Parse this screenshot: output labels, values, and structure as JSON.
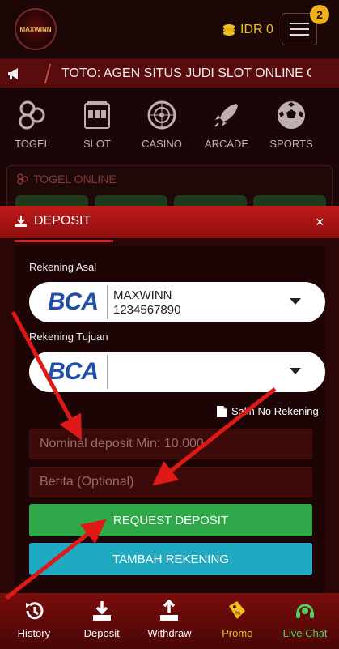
{
  "header": {
    "logo_text": "MAXWINN",
    "balance": "IDR 0",
    "notification_count": "2"
  },
  "marquee": {
    "text": "TOTO: AGEN SITUS JUDI SLOT ONLINE GACOR"
  },
  "games": [
    {
      "label": "TOGEL",
      "icon": "lottery-balls-icon"
    },
    {
      "label": "SLOT",
      "icon": "slot-machine-icon"
    },
    {
      "label": "CASINO",
      "icon": "roulette-icon"
    },
    {
      "label": "ARCADE",
      "icon": "rocket-icon"
    },
    {
      "label": "SPORTS",
      "icon": "soccer-ball-icon"
    }
  ],
  "togel": {
    "title": "TOGEL ONLINE"
  },
  "deposit": {
    "title": "DEPOSIT",
    "close": "×",
    "source_label": "Rekening Asal",
    "source_bank": "BCA",
    "source_name": "MAXWINN",
    "source_number": "1234567890",
    "target_label": "Rekening Tujuan",
    "target_bank": "BCA",
    "save_account": "Salin No Rekening",
    "amount_placeholder": "Nominal deposit Min: 10.000",
    "note_placeholder": "Berita (Optional)",
    "request_button": "REQUEST DEPOSIT",
    "add_account_button": "TAMBAH REKENING"
  },
  "bottom_nav": [
    {
      "label": "History",
      "icon": "history-icon"
    },
    {
      "label": "Deposit",
      "icon": "download-icon"
    },
    {
      "label": "Withdraw",
      "icon": "upload-icon"
    },
    {
      "label": "Promo",
      "icon": "promo-tag-icon"
    },
    {
      "label": "Live Chat",
      "icon": "headset-icon"
    }
  ],
  "colors": {
    "primary_red": "#c21a1a",
    "gold": "#f0c020",
    "green": "#2fa84a",
    "teal": "#20aac2"
  }
}
